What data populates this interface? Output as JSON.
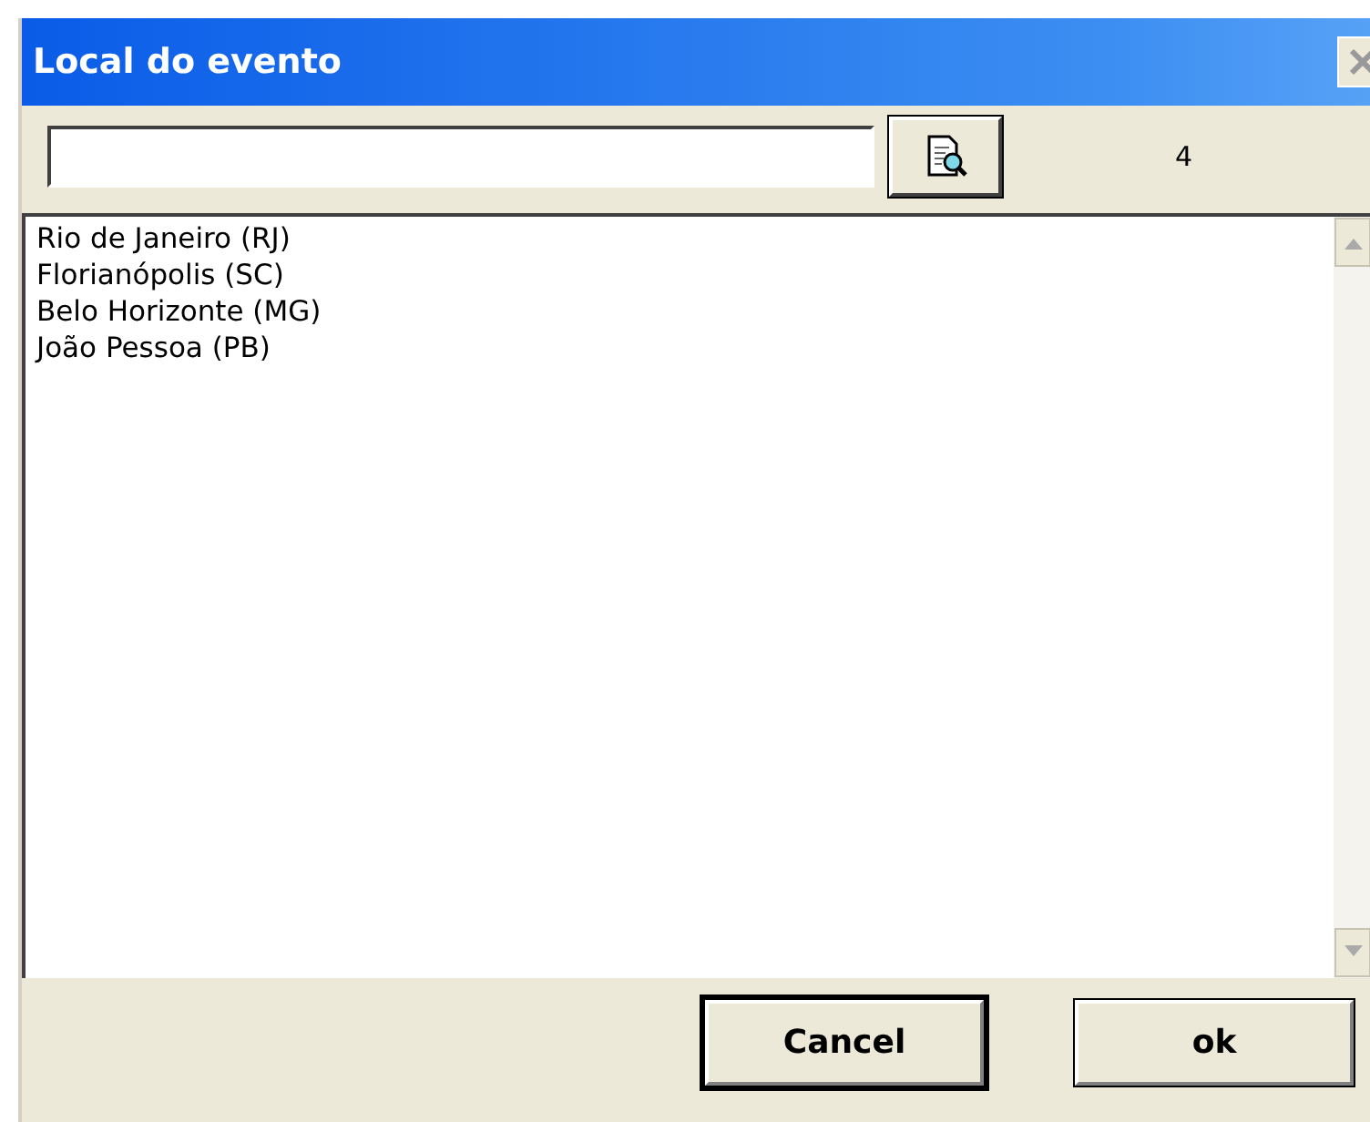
{
  "window": {
    "title": "Local do evento"
  },
  "count": "4",
  "list": {
    "items": [
      {
        "label": "Rio de Janeiro (RJ)"
      },
      {
        "label": "Florianópolis (SC)"
      },
      {
        "label": "Belo Horizonte (MG)"
      },
      {
        "label": "João Pessoa (PB)"
      }
    ]
  },
  "buttons": [
    {
      "label": "Cancel",
      "kind": "default"
    },
    {
      "label": "ok",
      "kind": "normal"
    }
  ]
}
